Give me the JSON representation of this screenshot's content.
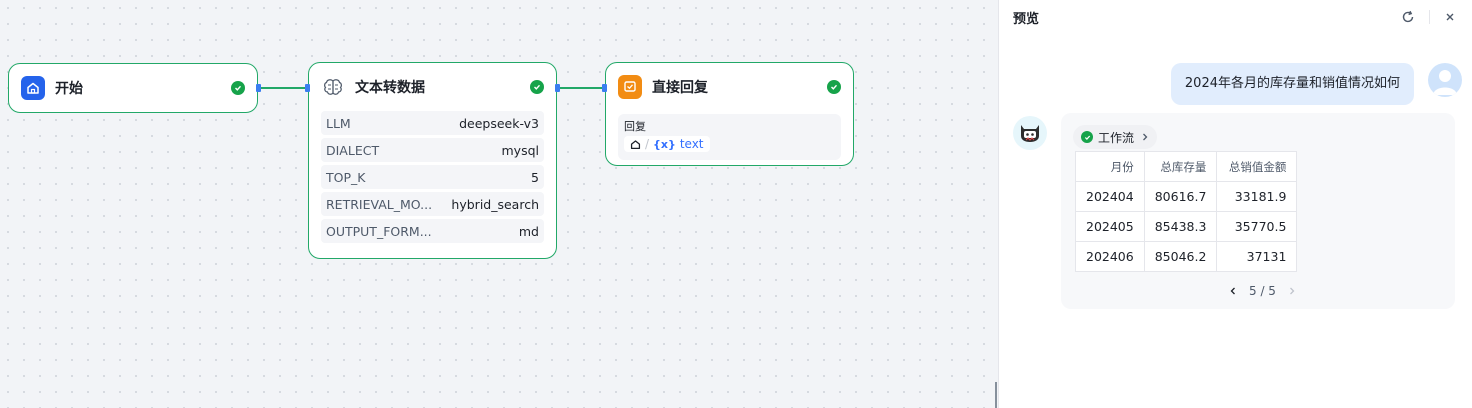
{
  "canvas": {
    "nodes": {
      "start": {
        "title": "开始"
      },
      "text2data": {
        "title": "文本转数据",
        "params": [
          {
            "key": "LLM",
            "value": "deepseek-v3"
          },
          {
            "key": "DIALECT",
            "value": "mysql"
          },
          {
            "key": "TOP_K",
            "value": "5"
          },
          {
            "key": "RETRIEVAL_MO...",
            "value": "hybrid_search"
          },
          {
            "key": "OUTPUT_FORM...",
            "value": "md"
          }
        ]
      },
      "reply": {
        "title": "直接回复",
        "reply_label": "回复",
        "var_sep": "/",
        "var_symbol": "{x}",
        "var_name": "text"
      }
    },
    "colors": {
      "success": "#16a34a",
      "edge": "#22a868",
      "start_icon": "#2563eb",
      "reply_icon": "#f28c13"
    }
  },
  "preview": {
    "title": "预览",
    "user_message": "2024年各月的库存量和销值情况如何",
    "workflow_tag": "工作流",
    "table": {
      "headers": [
        "月份",
        "总库存量",
        "总销值金额"
      ],
      "rows": [
        [
          "202404",
          "80616.7",
          "33181.9"
        ],
        [
          "202405",
          "85438.3",
          "35770.5"
        ],
        [
          "202406",
          "85046.2",
          "37131"
        ]
      ]
    },
    "pagination": "5 / 5"
  }
}
